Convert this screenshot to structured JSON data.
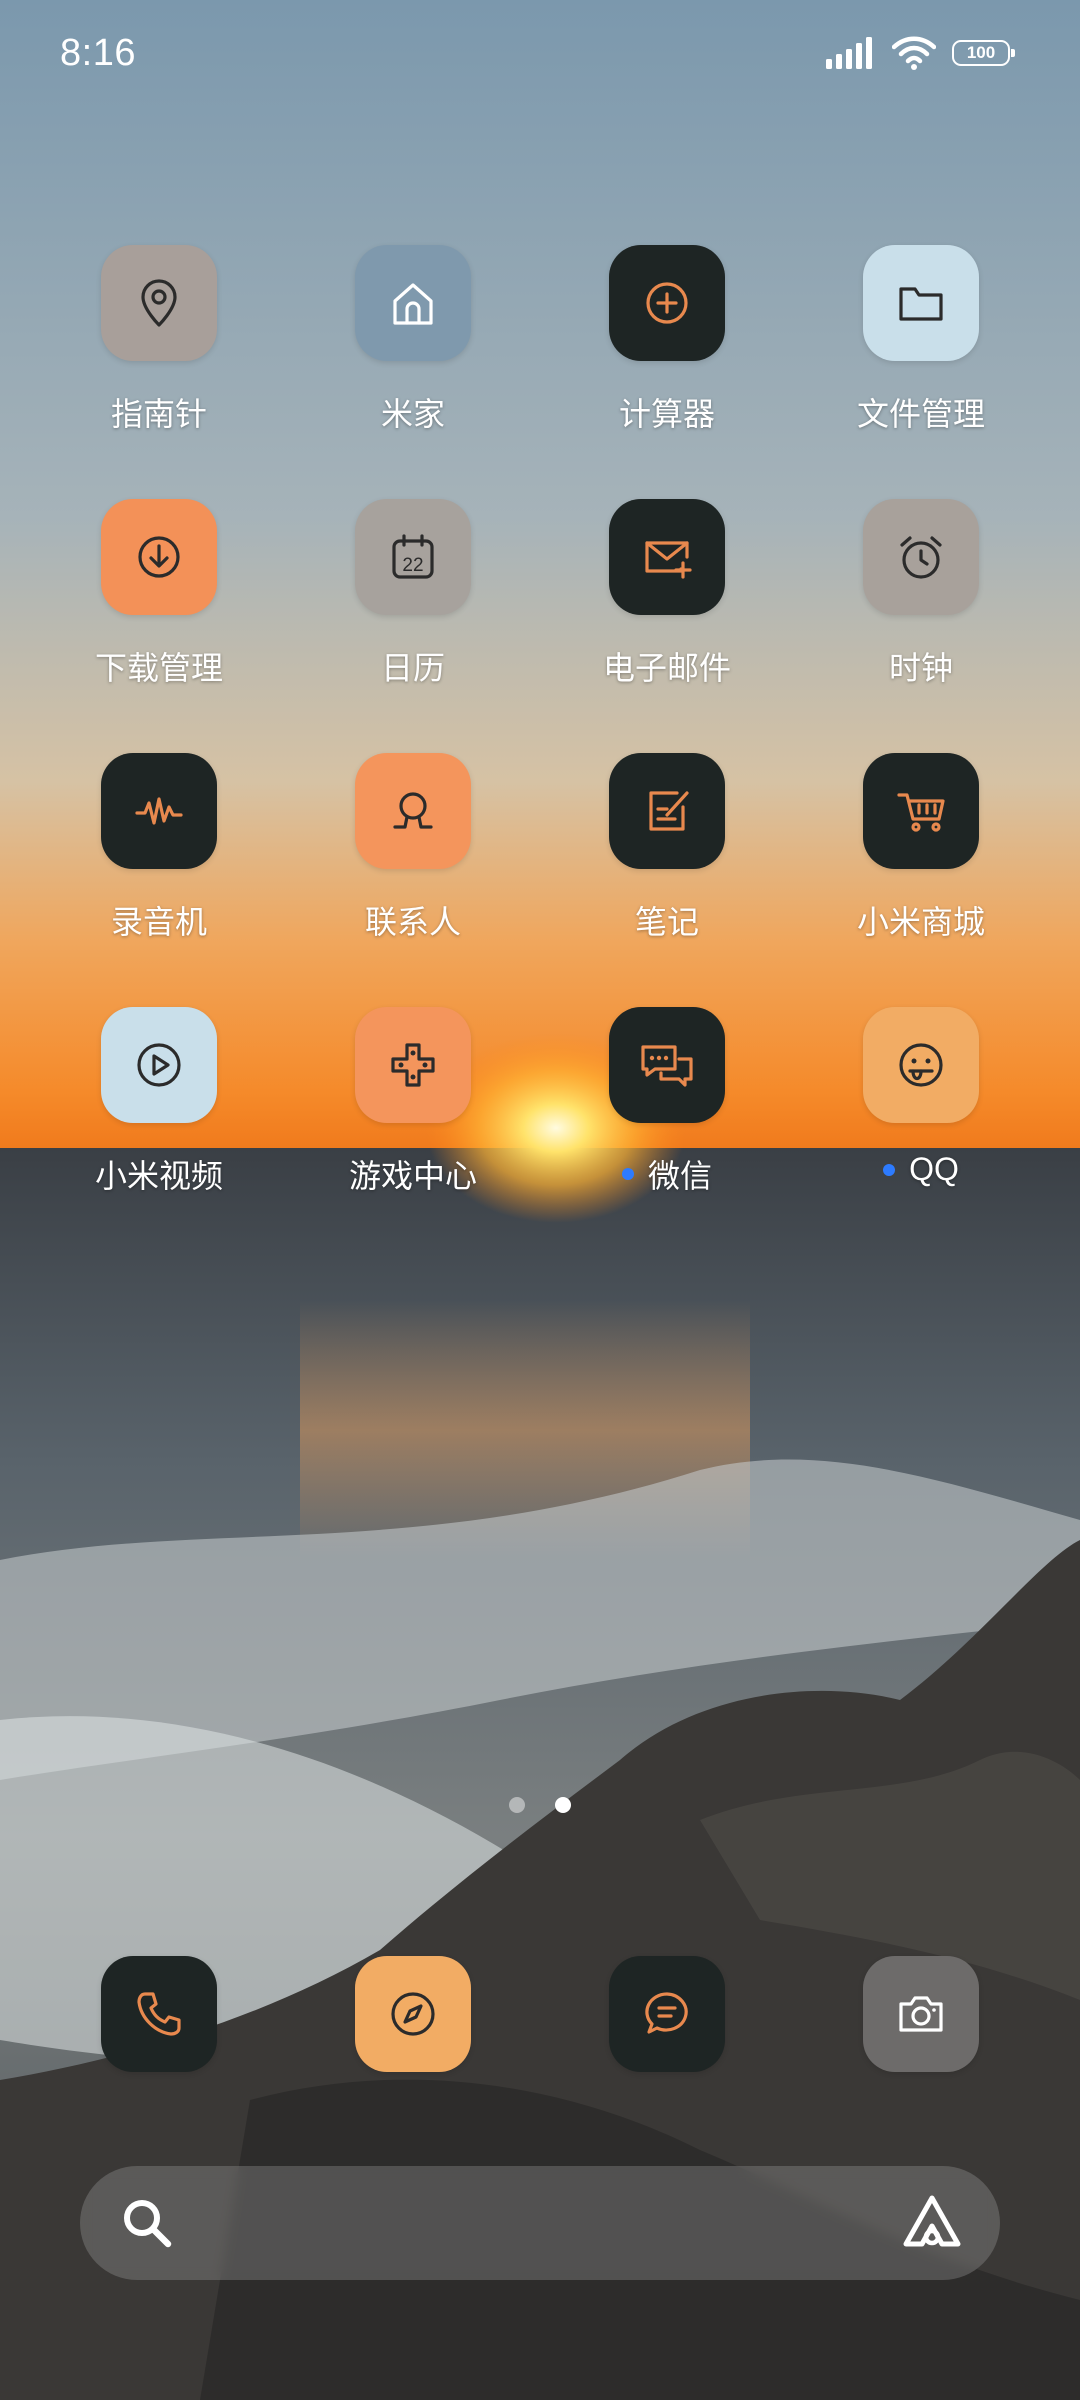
{
  "status_bar": {
    "time": "8:16",
    "battery": "100",
    "signal_icon": "signal-icon",
    "wifi_icon": "wifi-icon"
  },
  "apps": [
    {
      "label": "指南针",
      "icon": "location-pin-icon",
      "bg": "#a89f9a",
      "fg": "#2b2b2b"
    },
    {
      "label": "米家",
      "icon": "home-icon",
      "bg": "#7f99ad",
      "fg": "#ffffff"
    },
    {
      "label": "计算器",
      "icon": "plus-circle-icon",
      "bg": "#1e2524",
      "fg": "#e8894e"
    },
    {
      "label": "文件管理",
      "icon": "folder-icon",
      "bg": "#c9dfea",
      "fg": "#2b2b2b"
    },
    {
      "label": "下载管理",
      "icon": "download-icon",
      "bg": "#f39158",
      "fg": "#2b2b2b"
    },
    {
      "label": "日历",
      "icon": "calendar-icon",
      "bg": "#a7a29d",
      "fg": "#2b2b2b",
      "calendar_day": "22"
    },
    {
      "label": "电子邮件",
      "icon": "mail-icon",
      "bg": "#1e2524",
      "fg": "#e8894e"
    },
    {
      "label": "时钟",
      "icon": "alarm-clock-icon",
      "bg": "#a8a19b",
      "fg": "#2b2b2b"
    },
    {
      "label": "录音机",
      "icon": "waveform-icon",
      "bg": "#1e2524",
      "fg": "#e8894e"
    },
    {
      "label": "联系人",
      "icon": "contact-icon",
      "bg": "#f4955c",
      "fg": "#2b2b2b"
    },
    {
      "label": "笔记",
      "icon": "note-icon",
      "bg": "#1e2524",
      "fg": "#e8894e"
    },
    {
      "label": "小米商城",
      "icon": "cart-icon",
      "bg": "#1e2524",
      "fg": "#e8894e"
    },
    {
      "label": "小米视频",
      "icon": "play-icon",
      "bg": "#c9dfea",
      "fg": "#2b2b2b"
    },
    {
      "label": "游戏中心",
      "icon": "gamepad-icon",
      "bg": "#f4955c",
      "fg": "#2b2b2b"
    },
    {
      "label": "微信",
      "icon": "chat-bubbles-icon",
      "bg": "#1e2524",
      "fg": "#e8894e",
      "notify": true
    },
    {
      "label": "QQ",
      "icon": "smiley-icon",
      "bg": "#f2ac64",
      "fg": "#2b2b2b",
      "notify": true
    }
  ],
  "dock": [
    {
      "name": "phone",
      "icon": "phone-icon",
      "bg": "#1e2524",
      "fg": "#e8894e"
    },
    {
      "name": "browser",
      "icon": "compass-icon",
      "bg": "#f2ac64",
      "fg": "#2b2b2b"
    },
    {
      "name": "messages",
      "icon": "message-icon",
      "bg": "#1e2524",
      "fg": "#e8894e"
    },
    {
      "name": "camera",
      "icon": "camera-icon",
      "bg": "#6d6b6a",
      "fg": "#ffffff"
    }
  ],
  "page_indicator": {
    "pages": 2,
    "current": 2
  },
  "search": {
    "search_icon": "search-icon",
    "assistant_icon": "assistant-icon"
  }
}
